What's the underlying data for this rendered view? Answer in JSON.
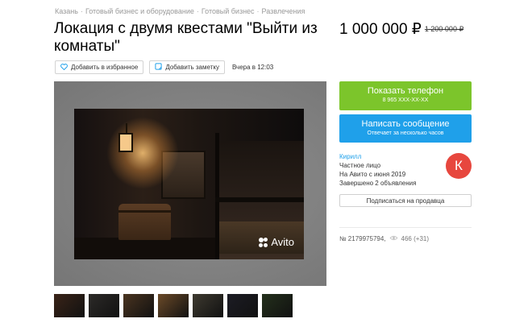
{
  "breadcrumb": {
    "items": [
      "Казань",
      "Готовый бизнес и оборудование",
      "Готовый бизнес",
      "Развлечения"
    ],
    "separator": "·"
  },
  "listing": {
    "title": "Локация с двумя квестами \"Выйти из комнаты\"",
    "price": "1 000 000 ₽",
    "old_price": "1 200 000 ₽"
  },
  "actions": {
    "favorite_label": "Добавить в избранное",
    "note_label": "Добавить заметку",
    "date": "Вчера в 12:03"
  },
  "gallery": {
    "watermark": "Avito",
    "thumb_colors": [
      "#3a2418",
      "#2c2a28",
      "#4a3420",
      "#6b4a28",
      "#3e3a30",
      "#1c1c24",
      "#24301c"
    ]
  },
  "contact": {
    "phone_label": "Показать телефон",
    "phone_masked": "8 965 XXX-XX-XX",
    "message_label": "Написать сообщение",
    "message_sub": "Отвечает за несколько часов"
  },
  "seller": {
    "name": "Кирилл",
    "type": "Частное лицо",
    "since": "На Авито с июня 2019",
    "completed": "Завершено 2 объявления",
    "avatar_letter": "К",
    "subscribe_label": "Подписаться на продавца"
  },
  "meta": {
    "item_number": "№ 2179975794,",
    "views": "466 (+31)"
  },
  "colors": {
    "green": "#7cc52b",
    "blue": "#1fa0ea",
    "avatar": "#e7473e"
  }
}
